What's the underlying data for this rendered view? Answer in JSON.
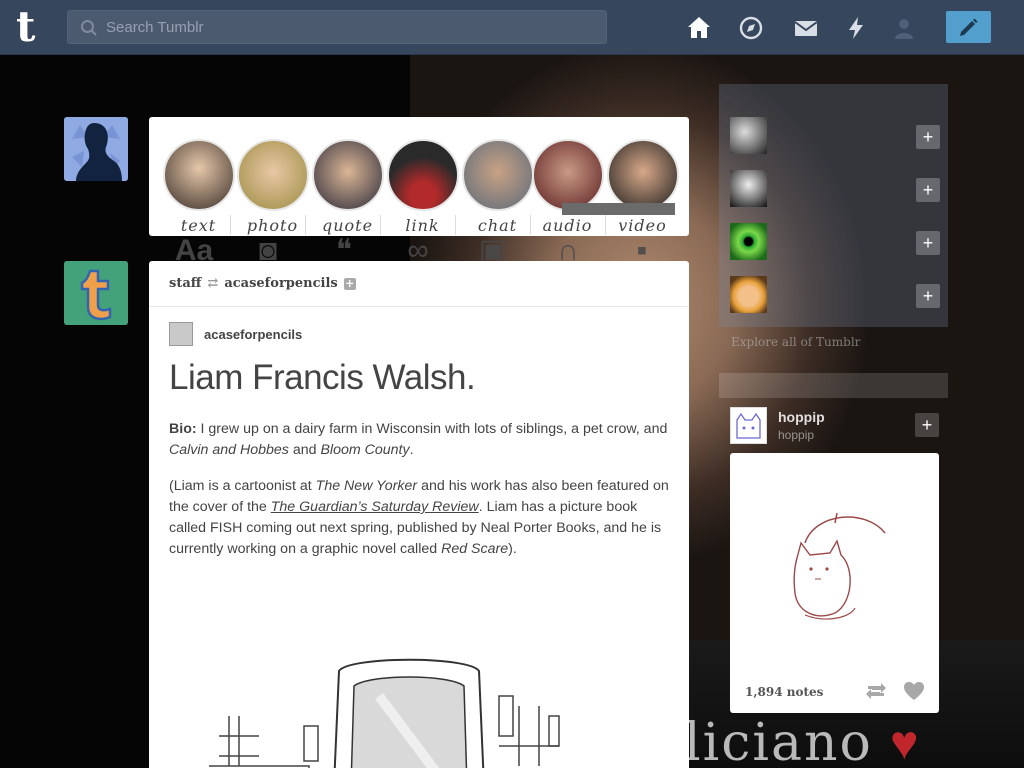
{
  "header": {
    "search_placeholder": "Search Tumblr",
    "logo_letter": "t",
    "colors": {
      "bar": "#36465d",
      "compose": "#529ecc"
    }
  },
  "post_types": [
    {
      "label": "text",
      "icon": "Aa"
    },
    {
      "label": "photo",
      "icon": "camera-icon"
    },
    {
      "label": "quote",
      "icon": "quote-icon"
    },
    {
      "label": "link",
      "icon": "link-icon"
    },
    {
      "label": "chat",
      "icon": "chat-icon"
    },
    {
      "label": "audio",
      "icon": "headphones-icon"
    },
    {
      "label": "video",
      "icon": "video-camera-icon"
    }
  ],
  "post": {
    "header_user": "staff",
    "header_reblogged_from": "acaseforpencils",
    "author": "acaseforpencils",
    "title": "Liam Francis Walsh.",
    "bio_label": "Bio:",
    "bio_text_1": " I grew up on a dairy farm in Wisconsin with lots of siblings, a pet crow, and ",
    "bio_italic_1": "Calvin and Hobbes",
    "bio_text_2": " and ",
    "bio_italic_2": "Bloom County",
    "bio_text_3": ".",
    "para2_1": "(Liam is a cartoonist at ",
    "para2_italic_1": "The New Yorker",
    "para2_2": " and his work has also been featured on the cover of the ",
    "para2_link": "The Guardian’s Saturday Review",
    "para2_3": ". Liam has a picture book called FISH coming out next spring, published by Neal Porter Books, and he is currently working on a graphic novel called ",
    "para2_italic_2": "Red Scare",
    "para2_4": ")."
  },
  "sidebar": {
    "explore_label": "Explore all of Tumblr",
    "radar": {
      "name": "hoppip",
      "sub": "hoppip",
      "notes": "1,894 notes"
    }
  },
  "background": {
    "name_text": "liciano"
  }
}
